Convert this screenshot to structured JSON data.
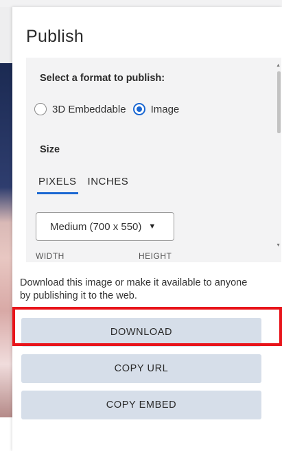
{
  "dialog": {
    "title": "Publish"
  },
  "format": {
    "heading": "Select a format to publish:",
    "options": [
      {
        "label": "3D Embeddable",
        "selected": false
      },
      {
        "label": "Image",
        "selected": true
      }
    ]
  },
  "size": {
    "heading": "Size",
    "tabs": [
      {
        "label": "PIXELS",
        "active": true
      },
      {
        "label": "INCHES",
        "active": false
      }
    ],
    "preset": "Medium (700 x 550)",
    "width_label": "WIDTH",
    "height_label": "HEIGHT"
  },
  "info": {
    "text": "Download this image or make it available to anyone by publishing it to the web."
  },
  "actions": {
    "download": "DOWNLOAD",
    "copy_url": "COPY URL",
    "copy_embed": "COPY EMBED"
  },
  "colors": {
    "accent": "#1a67d2",
    "button_bg": "#d6dee9",
    "highlight": "#e8141a"
  }
}
